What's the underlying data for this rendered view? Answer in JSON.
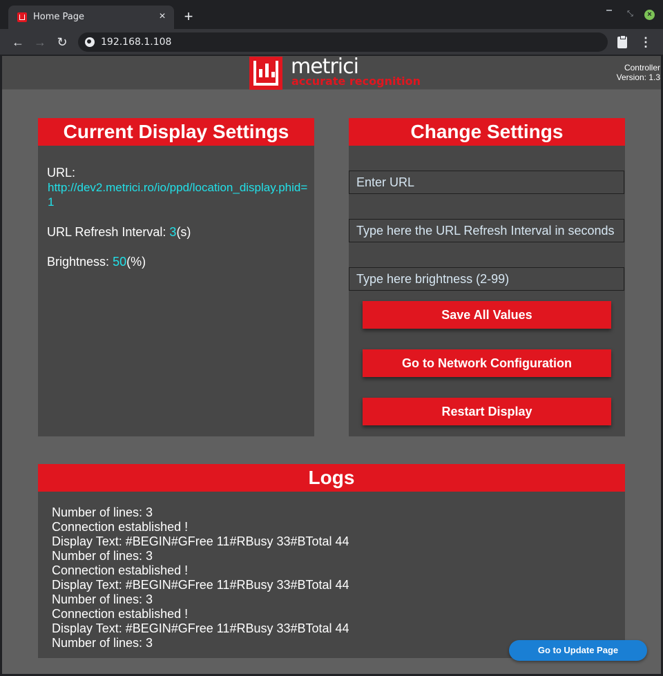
{
  "browser": {
    "tab_title": "Home Page",
    "tab_close": "×",
    "new_tab": "+",
    "address": "192.168.1.108",
    "back": "←",
    "forward": "→",
    "reload": "↻",
    "menu": "⋮"
  },
  "header": {
    "logo_word": "metrici",
    "logo_tagline": "accurate recognition",
    "controller_label": "Controller",
    "version": "Version: 1.3"
  },
  "current_settings": {
    "title": "Current Display Settings",
    "url_label": "URL:",
    "url_value": "http://dev2.metrici.ro/io/ppd/location_display.phid=1",
    "refresh_label": "URL Refresh Interval:",
    "refresh_value": "3",
    "refresh_unit": "(s)",
    "brightness_label": "Brightness:",
    "brightness_value": "50",
    "brightness_unit": "(%)"
  },
  "change_settings": {
    "title": "Change Settings",
    "url_placeholder": "Enter URL",
    "refresh_placeholder": "Type here the URL Refresh Interval in seconds",
    "brightness_placeholder": "Type here brightness (2-99)",
    "save_button": "Save All Values",
    "network_button": "Go to Network Configuration",
    "restart_button": "Restart Display"
  },
  "logs": {
    "title": "Logs",
    "lines": [
      "Number of lines: 3",
      "Connection established !",
      "Display Text: #BEGIN#GFree 11#RBusy 33#BTotal 44",
      "Number of lines: 3",
      "Connection established !",
      "Display Text: #BEGIN#GFree 11#RBusy 33#BTotal 44",
      "Number of lines: 3",
      "Connection established !",
      "Display Text: #BEGIN#GFree 11#RBusy 33#BTotal 44",
      "Number of lines: 3"
    ]
  },
  "update_button": "Go to Update Page",
  "colors": {
    "brand_red": "#e0161f",
    "value_cyan": "#22e0e8",
    "update_blue": "#1a7fd4"
  }
}
